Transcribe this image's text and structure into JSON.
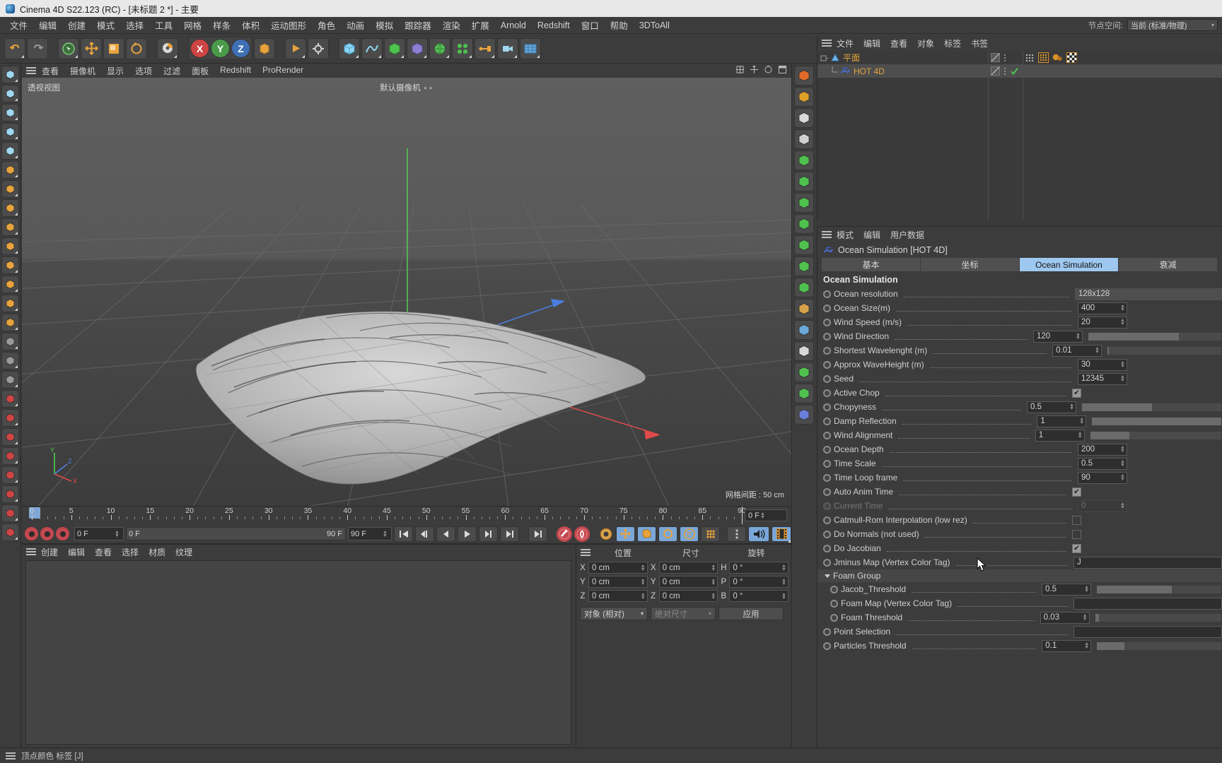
{
  "window": {
    "title": "Cinema 4D S22.123 (RC) - [未标题 2 *] - 主要",
    "logo": "c4d-logo"
  },
  "menubar": {
    "items": [
      "文件",
      "编辑",
      "创建",
      "模式",
      "选择",
      "工具",
      "网格",
      "样条",
      "体积",
      "运动图形",
      "角色",
      "动画",
      "模拟",
      "跟踪器",
      "渲染",
      "扩展",
      "Arnold",
      "Redshift",
      "窗口",
      "帮助",
      "3DToAll"
    ],
    "nodespace_label": "节点空间:",
    "nodespace_value": "当前 (标准/物理)"
  },
  "viewport": {
    "menu": [
      "查看",
      "摄像机",
      "显示",
      "选项",
      "过滤",
      "面板",
      "Redshift",
      "ProRender"
    ],
    "view_label": "透视视图",
    "camera_label": "默认摄像机",
    "grid_label": "网格间距 : 50 cm",
    "axis_labels": {
      "x": "X",
      "y": "Y",
      "z": "Z"
    }
  },
  "timeline": {
    "ticks": [
      0,
      5,
      10,
      15,
      20,
      25,
      30,
      35,
      40,
      45,
      50,
      55,
      60,
      65,
      70,
      75,
      80,
      85,
      90
    ],
    "current_frame_field": "0 F",
    "start_frame": "0 F",
    "end_frame": "0 F",
    "range_end": "90 F",
    "preview_end": "90 F"
  },
  "bottom_manager": {
    "menu": [
      "创建",
      "编辑",
      "查看",
      "选择",
      "材质",
      "纹理"
    ]
  },
  "coordinates": {
    "headers": [
      "位置",
      "尺寸",
      "旋转"
    ],
    "position": {
      "x": "0 cm",
      "y": "0 cm",
      "z": "0 cm"
    },
    "size": {
      "x": "0 cm",
      "y": "0 cm",
      "z": "0 cm"
    },
    "rotation": {
      "h": "0 °",
      "p": "0 °",
      "b": "0 °"
    },
    "mode_select": "对象 (相对)",
    "size_select": "绝对尺寸",
    "apply_button": "应用"
  },
  "object_manager": {
    "menu": [
      "文件",
      "编辑",
      "查看",
      "对象",
      "标签",
      "书签"
    ],
    "items": [
      {
        "name": "平面",
        "icon": "plane-object-icon",
        "selected": false
      },
      {
        "name": "HOT 4D",
        "icon": "ocean-tag-icon",
        "selected": true
      }
    ]
  },
  "attribute_manager": {
    "menu": [
      "模式",
      "编辑",
      "用户数据"
    ],
    "object_title": "Ocean Simulation [HOT 4D]",
    "tabs": [
      {
        "label": "基本",
        "active": false
      },
      {
        "label": "坐标",
        "active": false
      },
      {
        "label": "Ocean Simulation",
        "active": true
      },
      {
        "label": "衰减",
        "active": false
      }
    ],
    "section_title": "Ocean Simulation",
    "params": [
      {
        "label": "Ocean resolution",
        "value": "128x128",
        "type": "dropdown"
      },
      {
        "label": "Ocean Size(m)",
        "value": "400",
        "type": "number"
      },
      {
        "label": "Wind Speed (m/s)",
        "value": "20",
        "type": "number"
      },
      {
        "label": "Wind Direction",
        "value": "120",
        "type": "number",
        "slider": true,
        "fill": 68
      },
      {
        "label": "Shortest Wavelenght (m)",
        "value": "0.01",
        "type": "number",
        "slider": true,
        "fill": 1
      },
      {
        "label": "Approx WaveHeight (m)",
        "value": "30",
        "type": "number"
      },
      {
        "label": "Seed",
        "value": "12345",
        "type": "number"
      },
      {
        "label": "Active Chop",
        "value": true,
        "type": "checkbox"
      },
      {
        "label": "Chopyness",
        "value": "0.5",
        "type": "number",
        "slider": true,
        "fill": 50
      },
      {
        "label": "Damp Reflection",
        "value": "1",
        "type": "number",
        "slider": true,
        "fill": 100
      },
      {
        "label": "Wind Alignment",
        "value": "1",
        "type": "number",
        "slider": true,
        "fill": 30
      },
      {
        "label": "Ocean Depth",
        "value": "200",
        "type": "number"
      },
      {
        "label": "Time Scale",
        "value": "0.5",
        "type": "number"
      },
      {
        "label": "Time Loop frame",
        "value": "90",
        "type": "number"
      },
      {
        "label": "Auto Anim Time",
        "value": true,
        "type": "checkbox"
      },
      {
        "label": "Current Time",
        "value": "0",
        "type": "number",
        "disabled": true
      },
      {
        "label": "Catmull-Rom Interpolation (low rez)",
        "value": false,
        "type": "checkbox"
      },
      {
        "label": "Do Normals (not used)",
        "value": false,
        "type": "checkbox"
      },
      {
        "label": "Do Jacobian",
        "value": true,
        "type": "checkbox"
      },
      {
        "label": "Jminus Map (Vertex Color Tag)",
        "value": "J",
        "type": "link"
      }
    ],
    "foam_group": {
      "label": "Foam Group",
      "params": [
        {
          "label": "Jacob_Threshold",
          "value": "0.5",
          "type": "number",
          "slider": true,
          "fill": 60
        },
        {
          "label": "Foam Map (Vertex Color Tag)",
          "value": "",
          "type": "link"
        },
        {
          "label": "Foam Threshold",
          "value": "0.03",
          "type": "number",
          "slider": true,
          "fill": 3
        }
      ]
    },
    "trailing_params": [
      {
        "label": "Point Selection",
        "value": "",
        "type": "link"
      },
      {
        "label": "Particles Threshold",
        "value": "0.1",
        "type": "number",
        "slider": true,
        "fill": 22
      }
    ]
  },
  "statusbar": {
    "text": "顶点颜色 标签 [J]"
  },
  "colors": {
    "accent_blue": "#9ec8ef",
    "object_orange": "#e2a53c",
    "panel_bg": "#3c3c3c",
    "field_bg": "#2e2e2e"
  }
}
